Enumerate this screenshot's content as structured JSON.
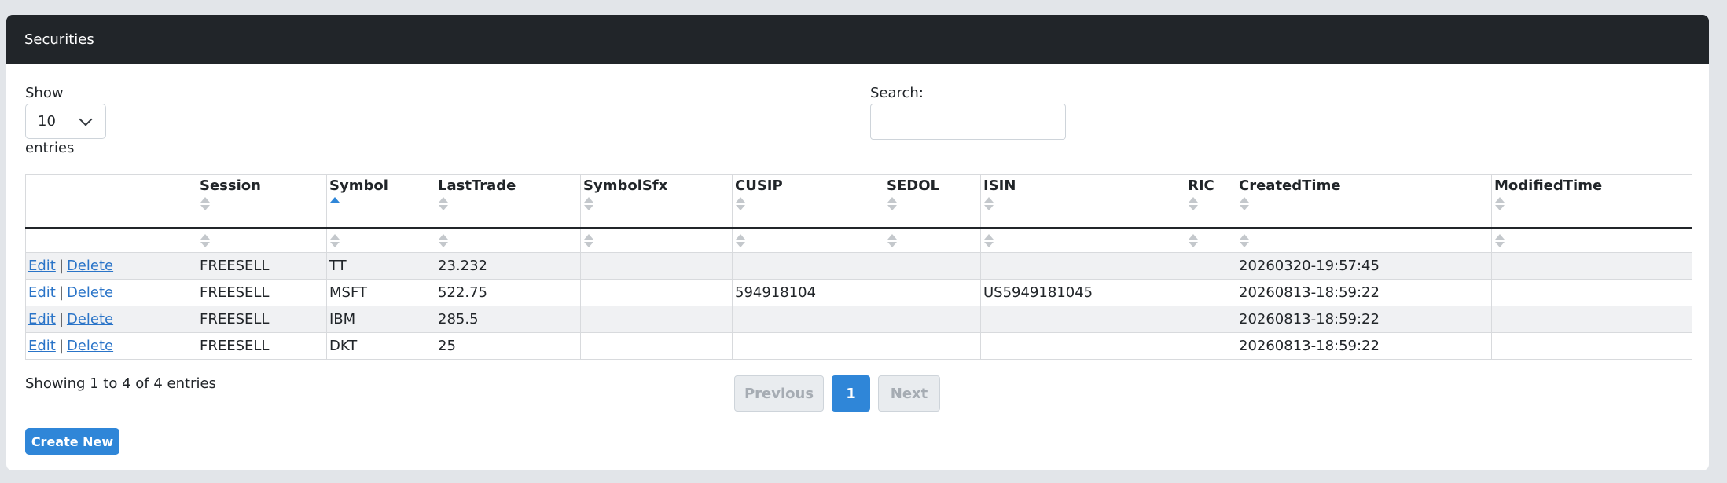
{
  "card": {
    "title": "Securities"
  },
  "length": {
    "label": "Show",
    "value": "10",
    "suffix": "entries"
  },
  "search": {
    "label": "Search:",
    "value": ""
  },
  "table": {
    "columns": [
      "",
      "Session",
      "Symbol",
      "LastTrade",
      "SymbolSfx",
      "CUSIP",
      "SEDOL",
      "ISIN",
      "RIC",
      "CreatedTime",
      "ModifiedTime"
    ],
    "rows": [
      {
        "edit": "Edit",
        "sep": "|",
        "delete": "Delete",
        "session": "FREESELL",
        "symbol": "TT",
        "lasttrade": "23.232",
        "symbolsfx": "",
        "cusip": "",
        "sedol": "",
        "isin": "",
        "ric": "",
        "created": "20260320-19:57:45",
        "modified": ""
      },
      {
        "edit": "Edit",
        "sep": "|",
        "delete": "Delete",
        "session": "FREESELL",
        "symbol": "MSFT",
        "lasttrade": "522.75",
        "symbolsfx": "",
        "cusip": "594918104",
        "sedol": "",
        "isin": "US5949181045",
        "ric": "",
        "created": "20260813-18:59:22",
        "modified": ""
      },
      {
        "edit": "Edit",
        "sep": "|",
        "delete": "Delete",
        "session": "FREESELL",
        "symbol": "IBM",
        "lasttrade": "285.5",
        "symbolsfx": "",
        "cusip": "",
        "sedol": "",
        "isin": "",
        "ric": "",
        "created": "20260813-18:59:22",
        "modified": ""
      },
      {
        "edit": "Edit",
        "sep": "|",
        "delete": "Delete",
        "session": "FREESELL",
        "symbol": "DKT",
        "lasttrade": "25",
        "symbolsfx": "",
        "cusip": "",
        "sedol": "",
        "isin": "",
        "ric": "",
        "created": "20260813-18:59:22",
        "modified": ""
      }
    ]
  },
  "info": "Showing 1 to 4 of 4 entries",
  "pagination": {
    "previous": "Previous",
    "current": "1",
    "next": "Next"
  },
  "create_button": "Create New",
  "colors": {
    "header_bg": "#212529",
    "accent": "#2f86d8",
    "link": "#2a74c8",
    "stripe": "#f0f1f3"
  }
}
